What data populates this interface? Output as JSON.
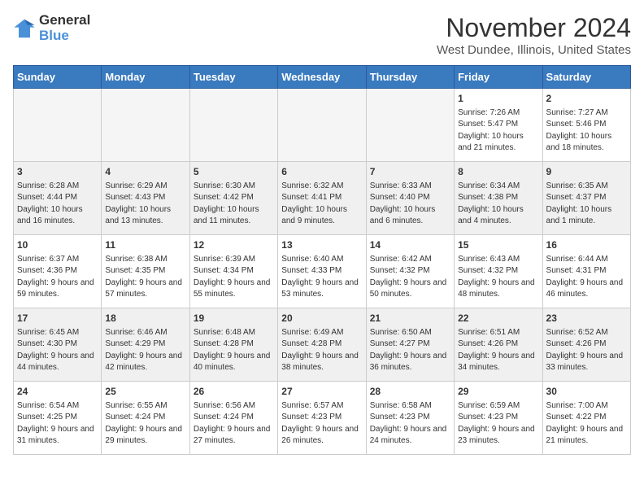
{
  "logo": {
    "line1": "General",
    "line2": "Blue"
  },
  "title": "November 2024",
  "subtitle": "West Dundee, Illinois, United States",
  "days_of_week": [
    "Sunday",
    "Monday",
    "Tuesday",
    "Wednesday",
    "Thursday",
    "Friday",
    "Saturday"
  ],
  "weeks": [
    [
      {
        "day": "",
        "info": ""
      },
      {
        "day": "",
        "info": ""
      },
      {
        "day": "",
        "info": ""
      },
      {
        "day": "",
        "info": ""
      },
      {
        "day": "",
        "info": ""
      },
      {
        "day": "1",
        "info": "Sunrise: 7:26 AM\nSunset: 5:47 PM\nDaylight: 10 hours and 21 minutes."
      },
      {
        "day": "2",
        "info": "Sunrise: 7:27 AM\nSunset: 5:46 PM\nDaylight: 10 hours and 18 minutes."
      }
    ],
    [
      {
        "day": "3",
        "info": "Sunrise: 6:28 AM\nSunset: 4:44 PM\nDaylight: 10 hours and 16 minutes."
      },
      {
        "day": "4",
        "info": "Sunrise: 6:29 AM\nSunset: 4:43 PM\nDaylight: 10 hours and 13 minutes."
      },
      {
        "day": "5",
        "info": "Sunrise: 6:30 AM\nSunset: 4:42 PM\nDaylight: 10 hours and 11 minutes."
      },
      {
        "day": "6",
        "info": "Sunrise: 6:32 AM\nSunset: 4:41 PM\nDaylight: 10 hours and 9 minutes."
      },
      {
        "day": "7",
        "info": "Sunrise: 6:33 AM\nSunset: 4:40 PM\nDaylight: 10 hours and 6 minutes."
      },
      {
        "day": "8",
        "info": "Sunrise: 6:34 AM\nSunset: 4:38 PM\nDaylight: 10 hours and 4 minutes."
      },
      {
        "day": "9",
        "info": "Sunrise: 6:35 AM\nSunset: 4:37 PM\nDaylight: 10 hours and 1 minute."
      }
    ],
    [
      {
        "day": "10",
        "info": "Sunrise: 6:37 AM\nSunset: 4:36 PM\nDaylight: 9 hours and 59 minutes."
      },
      {
        "day": "11",
        "info": "Sunrise: 6:38 AM\nSunset: 4:35 PM\nDaylight: 9 hours and 57 minutes."
      },
      {
        "day": "12",
        "info": "Sunrise: 6:39 AM\nSunset: 4:34 PM\nDaylight: 9 hours and 55 minutes."
      },
      {
        "day": "13",
        "info": "Sunrise: 6:40 AM\nSunset: 4:33 PM\nDaylight: 9 hours and 53 minutes."
      },
      {
        "day": "14",
        "info": "Sunrise: 6:42 AM\nSunset: 4:32 PM\nDaylight: 9 hours and 50 minutes."
      },
      {
        "day": "15",
        "info": "Sunrise: 6:43 AM\nSunset: 4:32 PM\nDaylight: 9 hours and 48 minutes."
      },
      {
        "day": "16",
        "info": "Sunrise: 6:44 AM\nSunset: 4:31 PM\nDaylight: 9 hours and 46 minutes."
      }
    ],
    [
      {
        "day": "17",
        "info": "Sunrise: 6:45 AM\nSunset: 4:30 PM\nDaylight: 9 hours and 44 minutes."
      },
      {
        "day": "18",
        "info": "Sunrise: 6:46 AM\nSunset: 4:29 PM\nDaylight: 9 hours and 42 minutes."
      },
      {
        "day": "19",
        "info": "Sunrise: 6:48 AM\nSunset: 4:28 PM\nDaylight: 9 hours and 40 minutes."
      },
      {
        "day": "20",
        "info": "Sunrise: 6:49 AM\nSunset: 4:28 PM\nDaylight: 9 hours and 38 minutes."
      },
      {
        "day": "21",
        "info": "Sunrise: 6:50 AM\nSunset: 4:27 PM\nDaylight: 9 hours and 36 minutes."
      },
      {
        "day": "22",
        "info": "Sunrise: 6:51 AM\nSunset: 4:26 PM\nDaylight: 9 hours and 34 minutes."
      },
      {
        "day": "23",
        "info": "Sunrise: 6:52 AM\nSunset: 4:26 PM\nDaylight: 9 hours and 33 minutes."
      }
    ],
    [
      {
        "day": "24",
        "info": "Sunrise: 6:54 AM\nSunset: 4:25 PM\nDaylight: 9 hours and 31 minutes."
      },
      {
        "day": "25",
        "info": "Sunrise: 6:55 AM\nSunset: 4:24 PM\nDaylight: 9 hours and 29 minutes."
      },
      {
        "day": "26",
        "info": "Sunrise: 6:56 AM\nSunset: 4:24 PM\nDaylight: 9 hours and 27 minutes."
      },
      {
        "day": "27",
        "info": "Sunrise: 6:57 AM\nSunset: 4:23 PM\nDaylight: 9 hours and 26 minutes."
      },
      {
        "day": "28",
        "info": "Sunrise: 6:58 AM\nSunset: 4:23 PM\nDaylight: 9 hours and 24 minutes."
      },
      {
        "day": "29",
        "info": "Sunrise: 6:59 AM\nSunset: 4:23 PM\nDaylight: 9 hours and 23 minutes."
      },
      {
        "day": "30",
        "info": "Sunrise: 7:00 AM\nSunset: 4:22 PM\nDaylight: 9 hours and 21 minutes."
      }
    ]
  ],
  "colors": {
    "header_bg": "#3a7abf",
    "header_text": "#ffffff",
    "accent": "#4a90d9"
  }
}
